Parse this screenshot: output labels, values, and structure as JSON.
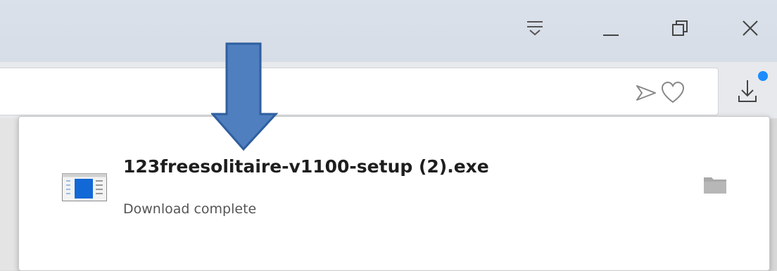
{
  "window_controls": {
    "tabs_menu_icon": "tabs-menu-icon",
    "minimize_icon": "minimize-icon",
    "restore_icon": "restore-icon",
    "close_icon": "close-icon"
  },
  "addressbar": {
    "url_value": "",
    "send_icon": "send-icon",
    "favorite_icon": "heart-icon",
    "downloads_icon": "download-icon"
  },
  "download_popup": {
    "filename": "123freesolitaire-v1100-setup (2).exe",
    "status": "Download complete",
    "file_icon": "exe-file-icon",
    "folder_icon": "folder-icon"
  },
  "annotation": {
    "arrow_icon": "down-arrow-annotation",
    "color": "#4f7fbf"
  }
}
